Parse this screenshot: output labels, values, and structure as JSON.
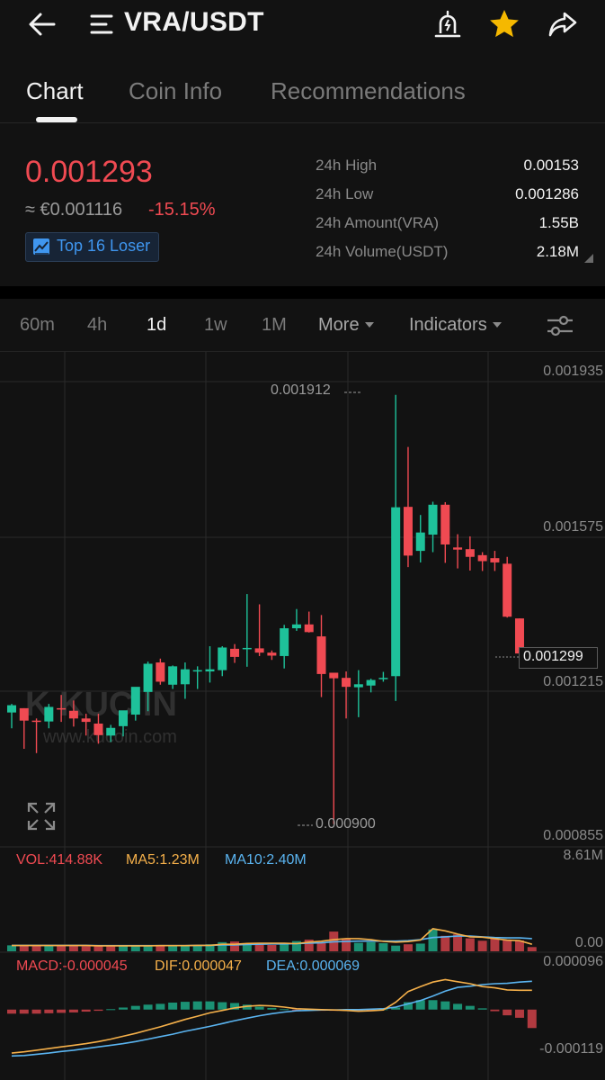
{
  "header": {
    "title": "VRA/USDT",
    "icons": [
      "back-arrow-icon",
      "menu-icon",
      "price-alert-icon",
      "star-icon",
      "share-icon"
    ],
    "star_color": "#f5b800"
  },
  "tabs": [
    {
      "label": "Chart",
      "active": true
    },
    {
      "label": "Coin Info",
      "active": false
    },
    {
      "label": "Recommendations",
      "active": false
    }
  ],
  "ticker": {
    "last_price": "0.001293",
    "fiat_price": "≈ €0.001116",
    "change_pct": "-15.15%",
    "badge": "Top 16 Loser",
    "stats": [
      {
        "label": "24h High",
        "value": "0.00153"
      },
      {
        "label": "24h Low",
        "value": "0.001286"
      },
      {
        "label": "24h Amount(VRA)",
        "value": "1.55B"
      },
      {
        "label": "24h Volume(USDT)",
        "value": "2.18M"
      }
    ]
  },
  "toolbar": {
    "intervals": [
      {
        "label": "60m",
        "active": false
      },
      {
        "label": "4h",
        "active": false
      },
      {
        "label": "1d",
        "active": true
      },
      {
        "label": "1w",
        "active": false
      },
      {
        "label": "1M",
        "active": false
      }
    ],
    "more_label": "More",
    "indicators_label": "Indicators",
    "settings_icon": "sliders-icon"
  },
  "colors": {
    "up": "#1ec29a",
    "down": "#f04a52",
    "ma5": "#f5b04a",
    "ma10": "#5ab4f0",
    "background": "#121212"
  },
  "chart_data": [
    {
      "type": "candlestick",
      "price_axis": {
        "min": 0.000855,
        "max": 0.001935,
        "ticks": [
          "0.001935",
          "0.001575",
          "0.001215",
          "0.000855"
        ]
      },
      "annotations": {
        "high": "0.001912",
        "low": "0.000900",
        "current": "0.001299"
      },
      "watermark": "KUCOIN www.kucoin.com",
      "candles": [
        {
          "o": 0.001161,
          "h": 0.001181,
          "l": 0.001124,
          "c": 0.001178
        },
        {
          "o": 0.001171,
          "h": 0.001171,
          "l": 0.001076,
          "c": 0.001142
        },
        {
          "o": 0.001142,
          "h": 0.001147,
          "l": 0.001066,
          "c": 0.00114
        },
        {
          "o": 0.00114,
          "h": 0.001181,
          "l": 0.001124,
          "c": 0.001174
        },
        {
          "o": 0.001171,
          "h": 0.001202,
          "l": 0.001139,
          "c": 0.001169
        },
        {
          "o": 0.001165,
          "h": 0.001189,
          "l": 0.001128,
          "c": 0.001147
        },
        {
          "o": 0.001147,
          "h": 0.001158,
          "l": 0.001107,
          "c": 0.001139
        },
        {
          "o": 0.001135,
          "h": 0.001158,
          "l": 0.001088,
          "c": 0.001108
        },
        {
          "o": 0.001107,
          "h": 0.001132,
          "l": 0.001092,
          "c": 0.001125
        },
        {
          "o": 0.001129,
          "h": 0.001164,
          "l": 0.001105,
          "c": 0.001166
        },
        {
          "o": 0.001156,
          "h": 0.001218,
          "l": 0.001142,
          "c": 0.001221
        },
        {
          "o": 0.001209,
          "h": 0.00128,
          "l": 0.001164,
          "c": 0.001275
        },
        {
          "o": 0.001278,
          "h": 0.001287,
          "l": 0.001226,
          "c": 0.001233
        },
        {
          "o": 0.001226,
          "h": 0.001271,
          "l": 0.001216,
          "c": 0.001269
        },
        {
          "o": 0.001227,
          "h": 0.001278,
          "l": 0.001193,
          "c": 0.001262
        },
        {
          "o": 0.001257,
          "h": 0.001269,
          "l": 0.001216,
          "c": 0.00126
        },
        {
          "o": 0.001257,
          "h": 0.001316,
          "l": 0.001231,
          "c": 0.001262
        },
        {
          "o": 0.00126,
          "h": 0.001316,
          "l": 0.001246,
          "c": 0.001313
        },
        {
          "o": 0.00131,
          "h": 0.001321,
          "l": 0.001277,
          "c": 0.001291
        },
        {
          "o": 0.001311,
          "h": 0.001438,
          "l": 0.001268,
          "c": 0.001312
        },
        {
          "o": 0.001311,
          "h": 0.001414,
          "l": 0.001293,
          "c": 0.001301
        },
        {
          "o": 0.001301,
          "h": 0.001306,
          "l": 0.001284,
          "c": 0.001294
        },
        {
          "o": 0.001293,
          "h": 0.001366,
          "l": 0.001264,
          "c": 0.001358
        },
        {
          "o": 0.001358,
          "h": 0.001403,
          "l": 0.001352,
          "c": 0.001367
        },
        {
          "o": 0.001367,
          "h": 0.001397,
          "l": 0.001348,
          "c": 0.001349
        },
        {
          "o": 0.001339,
          "h": 0.001389,
          "l": 0.001197,
          "c": 0.001251
        },
        {
          "o": 0.001254,
          "h": 0.001254,
          "l": 0.0009,
          "c": 0.001241
        },
        {
          "o": 0.001242,
          "h": 0.001257,
          "l": 0.001147,
          "c": 0.001221
        },
        {
          "o": 0.00122,
          "h": 0.00126,
          "l": 0.00115,
          "c": 0.001227
        },
        {
          "o": 0.001224,
          "h": 0.00124,
          "l": 0.001208,
          "c": 0.001237
        },
        {
          "o": 0.001239,
          "h": 0.001256,
          "l": 0.001233,
          "c": 0.001242
        },
        {
          "o": 0.001246,
          "h": 0.001904,
          "l": 0.001188,
          "c": 0.001641
        },
        {
          "o": 0.001642,
          "h": 0.001782,
          "l": 0.001501,
          "c": 0.001528
        },
        {
          "o": 0.001539,
          "h": 0.001623,
          "l": 0.001512,
          "c": 0.001582
        },
        {
          "o": 0.001577,
          "h": 0.001654,
          "l": 0.001536,
          "c": 0.001647
        },
        {
          "o": 0.001647,
          "h": 0.001653,
          "l": 0.001511,
          "c": 0.001554
        },
        {
          "o": 0.001547,
          "h": 0.001578,
          "l": 0.001498,
          "c": 0.001542
        },
        {
          "o": 0.001543,
          "h": 0.001573,
          "l": 0.001493,
          "c": 0.001525
        },
        {
          "o": 0.001529,
          "h": 0.001536,
          "l": 0.001492,
          "c": 0.001515
        },
        {
          "o": 0.001522,
          "h": 0.001539,
          "l": 0.001492,
          "c": 0.001512
        },
        {
          "o": 0.001509,
          "h": 0.001525,
          "l": 0.001383,
          "c": 0.001385
        },
        {
          "o": 0.001381,
          "h": 0.001381,
          "l": 0.001293,
          "c": 0.001299
        }
      ]
    },
    {
      "type": "bar",
      "title": "VOL",
      "labels": {
        "vol": "VOL:414.88K",
        "ma5": "MA5:1.23M",
        "ma10": "MA10:2.40M"
      },
      "ylim": [
        0,
        8.61
      ],
      "ticks": [
        "8.61M",
        "0.00"
      ],
      "unit": "M",
      "values": [
        0.62,
        0.62,
        0.62,
        0.62,
        0.62,
        0.55,
        0.51,
        0.58,
        0.51,
        0.55,
        0.58,
        0.55,
        0.66,
        0.55,
        0.62,
        0.62,
        0.73,
        0.95,
        1.02,
        0.76,
        0.84,
        0.66,
        0.8,
        1.06,
        1.21,
        0.95,
        2.05,
        1.32,
        0.88,
        0.95,
        0.84,
        0.59,
        0.73,
        0.8,
        2.27,
        1.61,
        1.76,
        1.35,
        1.1,
        1.32,
        1.17,
        1.13,
        0.44
      ],
      "up": [
        true,
        false,
        false,
        true,
        false,
        false,
        false,
        false,
        false,
        true,
        true,
        true,
        false,
        true,
        true,
        true,
        true,
        true,
        false,
        true,
        false,
        false,
        true,
        true,
        false,
        false,
        false,
        false,
        true,
        true,
        true,
        true,
        false,
        true,
        true,
        false,
        false,
        false,
        false,
        false,
        false,
        false,
        false
      ],
      "ma5": [
        0.6,
        0.6,
        0.6,
        0.6,
        0.6,
        0.6,
        0.6,
        0.57,
        0.57,
        0.57,
        0.57,
        0.57,
        0.59,
        0.59,
        0.59,
        0.62,
        0.62,
        0.73,
        0.73,
        0.81,
        0.84,
        0.84,
        0.84,
        0.8,
        0.95,
        1.05,
        1.21,
        1.32,
        1.32,
        1.21,
        1.03,
        0.95,
        1.01,
        1.17,
        2.35,
        2.12,
        1.79,
        1.51,
        1.47,
        1.32,
        1.16,
        1.1,
        0.73
      ],
      "ma10": [
        0.62,
        0.62,
        0.62,
        0.62,
        0.62,
        0.62,
        0.62,
        0.59,
        0.59,
        0.59,
        0.59,
        0.59,
        0.59,
        0.59,
        0.59,
        0.62,
        0.62,
        0.66,
        0.66,
        0.7,
        0.73,
        0.77,
        0.77,
        0.8,
        0.84,
        0.88,
        0.99,
        1.02,
        1.06,
        1.06,
        1.06,
        1.06,
        1.1,
        1.21,
        1.43,
        1.51,
        1.58,
        1.58,
        1.51,
        1.43,
        1.39,
        1.39,
        1.32
      ]
    },
    {
      "type": "bar",
      "title": "MACD",
      "labels": {
        "macd": "MACD:-0.000045",
        "dif": "DIF:0.000047",
        "dea": "DEA:0.000069"
      },
      "ylim": [
        -0.000119,
        9.6e-05
      ],
      "ticks": [
        "0.000096",
        "-0.000119"
      ],
      "histogram": [
        -1e-05,
        -1e-05,
        -1e-05,
        -9e-06,
        -8e-06,
        -7e-06,
        -5e-06,
        -3e-06,
        1e-06,
        5e-06,
        9e-06,
        1.2e-05,
        1.4e-05,
        1.7e-05,
        1.9e-05,
        2e-05,
        2e-05,
        1.8e-05,
        1.6e-05,
        1.2e-05,
        7e-06,
        4e-06,
        1e-06,
        -1e-06,
        -2e-06,
        -3e-06,
        -3e-06,
        -3e-06,
        -5e-06,
        -2e-06,
        1e-06,
        5e-06,
        1.8e-05,
        2.3e-05,
        2.3e-05,
        2e-05,
        1.4e-05,
        9e-06,
        3e-06,
        -4e-06,
        -1.4e-05,
        -2e-05,
        -4.5e-05
      ],
      "dif": [
        -0.000106,
        -0.000103,
        -9.9e-05,
        -9.5e-05,
        -9.1e-05,
        -8.7e-05,
        -8.3e-05,
        -7.8e-05,
        -7.2e-05,
        -6.5e-05,
        -5.8e-05,
        -5e-05,
        -4.2e-05,
        -3.3e-05,
        -2.4e-05,
        -1.6e-05,
        -8e-06,
        -2e-06,
        4e-06,
        8e-06,
        1e-05,
        9e-06,
        6e-06,
        2e-06,
        1e-06,
        0,
        -1e-06,
        -2e-06,
        -4e-06,
        -3e-06,
        -1e-06,
        1.8e-05,
        4.4e-05,
        5.6e-05,
        6.7e-05,
        7.3e-05,
        6.8e-05,
        6.3e-05,
        5.6e-05,
        5.3e-05,
        4.8e-05,
        4.7e-05,
        4.7e-05
      ],
      "dea": [
        -0.000113,
        -0.000112,
        -0.000109,
        -0.000106,
        -0.000102,
        -9.9e-05,
        -9.5e-05,
        -9.1e-05,
        -8.7e-05,
        -8.3e-05,
        -7.8e-05,
        -7.2e-05,
        -6.6e-05,
        -6e-05,
        -5.3e-05,
        -4.7e-05,
        -4.1e-05,
        -3.4e-05,
        -2.7e-05,
        -2.1e-05,
        -1.5e-05,
        -1e-05,
        -6e-06,
        -3e-06,
        -2e-06,
        -1e-06,
        -1e-06,
        0,
        0,
        1e-06,
        2e-06,
        6e-06,
        1.4e-05,
        2.2e-05,
        3.3e-05,
        4.5e-05,
        5.4e-05,
        5.7e-05,
        6.1e-05,
        6.3e-05,
        6.4e-05,
        6.7e-05,
        6.9e-05
      ]
    }
  ]
}
